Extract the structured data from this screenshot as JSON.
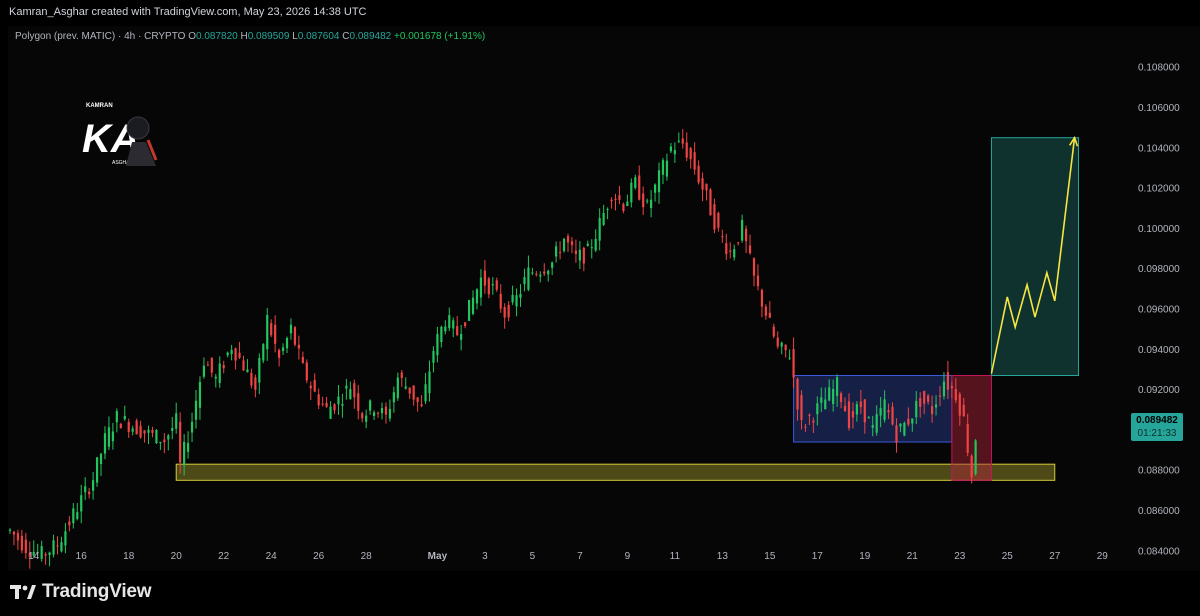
{
  "header": {
    "created_text": "Kamran_Asghar created with TradingView.com, May 23, 2026 14:38 UTC"
  },
  "legend": {
    "symbol": "Polygon (prev. MATIC) · 4h · CRYPTO",
    "open_key": "O",
    "open": "0.087820",
    "high_key": "H",
    "high": "0.089509",
    "low_key": "L",
    "low": "0.087604",
    "close_key": "C",
    "close": "0.089482",
    "change": "+0.001678 (+1.91%)"
  },
  "watermark": {
    "top_text": "KAMRAN",
    "letters": "KA",
    "bottom_text": "ASGHAR"
  },
  "price_tag": {
    "price": "0.089482",
    "countdown": "01:21:33"
  },
  "footer": {
    "brand": "TradingView"
  },
  "colors": {
    "up": "#22c55e",
    "down": "#ef4444",
    "support": "#d4cc3a",
    "range": "#3b5bdb",
    "target": "#26a69a",
    "stop": "#b4233a",
    "projection": "#f5e642"
  },
  "chart_data": {
    "type": "candlestick",
    "title": "",
    "y_axis": {
      "min": 0.083,
      "max": 0.109,
      "ticks": [
        0.084,
        0.086,
        0.088,
        0.09,
        0.092,
        0.094,
        0.096,
        0.098,
        0.1,
        0.102,
        0.104,
        0.106,
        0.108
      ],
      "tick_labels": [
        "0.084000",
        "0.086000",
        "0.088000",
        "0.090000",
        "0.092000",
        "0.094000",
        "0.096000",
        "0.098000",
        "0.100000",
        "0.102000",
        "0.104000",
        "0.106000",
        "0.108000"
      ]
    },
    "x_axis": {
      "start": "2026-04-13",
      "end": "2026-05-30",
      "ticks": [
        {
          "date": "2026-04-14",
          "label": "14"
        },
        {
          "date": "2026-04-16",
          "label": "16"
        },
        {
          "date": "2026-04-18",
          "label": "18"
        },
        {
          "date": "2026-04-20",
          "label": "20"
        },
        {
          "date": "2026-04-22",
          "label": "22"
        },
        {
          "date": "2026-04-24",
          "label": "24"
        },
        {
          "date": "2026-04-26",
          "label": "26"
        },
        {
          "date": "2026-04-28",
          "label": "28"
        },
        {
          "date": "2026-05-01",
          "label": "May"
        },
        {
          "date": "2026-05-03",
          "label": "3"
        },
        {
          "date": "2026-05-05",
          "label": "5"
        },
        {
          "date": "2026-05-07",
          "label": "7"
        },
        {
          "date": "2026-05-09",
          "label": "9"
        },
        {
          "date": "2026-05-11",
          "label": "11"
        },
        {
          "date": "2026-05-13",
          "label": "13"
        },
        {
          "date": "2026-05-15",
          "label": "15"
        },
        {
          "date": "2026-05-17",
          "label": "17"
        },
        {
          "date": "2026-05-19",
          "label": "19"
        },
        {
          "date": "2026-05-21",
          "label": "21"
        },
        {
          "date": "2026-05-23",
          "label": "23"
        },
        {
          "date": "2026-05-25",
          "label": "25"
        },
        {
          "date": "2026-05-27",
          "label": "27"
        },
        {
          "date": "2026-05-29",
          "label": "29"
        }
      ]
    },
    "price_path": [
      [
        "2026-04-13 00:00",
        0.085
      ],
      [
        "2026-04-13 16:00",
        0.0842
      ],
      [
        "2026-04-14 08:00",
        0.0838
      ],
      [
        "2026-04-15 00:00",
        0.0843
      ],
      [
        "2026-04-15 16:00",
        0.0858
      ],
      [
        "2026-04-16 12:00",
        0.0876
      ],
      [
        "2026-04-17 00:00",
        0.0895
      ],
      [
        "2026-04-17 12:00",
        0.0906
      ],
      [
        "2026-04-18 08:00",
        0.0901
      ],
      [
        "2026-04-18 20:00",
        0.0898
      ],
      [
        "2026-04-19 12:00",
        0.0895
      ],
      [
        "2026-04-20 00:00",
        0.0904
      ],
      [
        "2026-04-20 04:00",
        0.0882
      ],
      [
        "2026-04-20 16:00",
        0.0905
      ],
      [
        "2026-04-21 04:00",
        0.0935
      ],
      [
        "2026-04-21 16:00",
        0.0925
      ],
      [
        "2026-04-22 08:00",
        0.0942
      ],
      [
        "2026-04-22 20:00",
        0.0932
      ],
      [
        "2026-04-23 08:00",
        0.092
      ],
      [
        "2026-04-23 20:00",
        0.0955
      ],
      [
        "2026-04-24 08:00",
        0.0935
      ],
      [
        "2026-04-24 20:00",
        0.095
      ],
      [
        "2026-04-25 08:00",
        0.093
      ],
      [
        "2026-04-25 20:00",
        0.0918
      ],
      [
        "2026-04-26 08:00",
        0.091
      ],
      [
        "2026-04-26 20:00",
        0.0915
      ],
      [
        "2026-04-27 08:00",
        0.0922
      ],
      [
        "2026-04-27 20:00",
        0.0908
      ],
      [
        "2026-04-28 08:00",
        0.0912
      ],
      [
        "2026-04-28 20:00",
        0.0906
      ],
      [
        "2026-04-29 08:00",
        0.0926
      ],
      [
        "2026-04-29 20:00",
        0.092
      ],
      [
        "2026-04-30 08:00",
        0.091
      ],
      [
        "2026-04-30 20:00",
        0.094
      ],
      [
        "2026-05-01 08:00",
        0.0955
      ],
      [
        "2026-05-01 20:00",
        0.0948
      ],
      [
        "2026-05-02 08:00",
        0.096
      ],
      [
        "2026-05-02 20:00",
        0.0975
      ],
      [
        "2026-05-03 08:00",
        0.097
      ],
      [
        "2026-05-03 20:00",
        0.0958
      ],
      [
        "2026-05-04 08:00",
        0.0965
      ],
      [
        "2026-05-04 20:00",
        0.0978
      ],
      [
        "2026-05-05 08:00",
        0.098
      ],
      [
        "2026-05-05 20:00",
        0.0983
      ],
      [
        "2026-05-06 08:00",
        0.0995
      ],
      [
        "2026-05-06 20:00",
        0.0985
      ],
      [
        "2026-05-07 08:00",
        0.0988
      ],
      [
        "2026-05-07 20:00",
        0.1002
      ],
      [
        "2026-05-08 08:00",
        0.1018
      ],
      [
        "2026-05-08 20:00",
        0.1012
      ],
      [
        "2026-05-09 08:00",
        0.1022
      ],
      [
        "2026-05-09 20:00",
        0.101
      ],
      [
        "2026-05-10 08:00",
        0.1025
      ],
      [
        "2026-05-10 20:00",
        0.104
      ],
      [
        "2026-05-11 08:00",
        0.1042
      ],
      [
        "2026-05-11 20:00",
        0.103
      ],
      [
        "2026-05-12 08:00",
        0.1015
      ],
      [
        "2026-05-12 20:00",
        0.0998
      ],
      [
        "2026-05-13 08:00",
        0.0988
      ],
      [
        "2026-05-13 20:00",
        0.1
      ],
      [
        "2026-05-14 08:00",
        0.0975
      ],
      [
        "2026-05-14 20:00",
        0.0958
      ],
      [
        "2026-05-15 08:00",
        0.094
      ],
      [
        "2026-05-15 20:00",
        0.0938
      ],
      [
        "2026-05-16 08:00",
        0.0902
      ],
      [
        "2026-05-16 20:00",
        0.0908
      ],
      [
        "2026-05-17 08:00",
        0.0915
      ],
      [
        "2026-05-17 20:00",
        0.0922
      ],
      [
        "2026-05-18 08:00",
        0.0905
      ],
      [
        "2026-05-18 20:00",
        0.0912
      ],
      [
        "2026-05-19 08:00",
        0.09
      ],
      [
        "2026-05-19 20:00",
        0.0913
      ],
      [
        "2026-05-20 08:00",
        0.0898
      ],
      [
        "2026-05-20 20:00",
        0.0905
      ],
      [
        "2026-05-21 08:00",
        0.0915
      ],
      [
        "2026-05-21 20:00",
        0.091
      ],
      [
        "2026-05-22 08:00",
        0.0925
      ],
      [
        "2026-05-22 20:00",
        0.0918
      ],
      [
        "2026-05-23 04:00",
        0.0905
      ],
      [
        "2026-05-23 12:00",
        0.0878
      ],
      [
        "2026-05-23 16:00",
        0.08948
      ]
    ],
    "last_price": 0.089482,
    "zones": [
      {
        "kind": "support",
        "from": "2026-04-20 00:00",
        "to": "2026-05-27 00:00",
        "low": 0.0875,
        "high": 0.0883
      },
      {
        "kind": "range",
        "from": "2026-05-16 00:00",
        "to": "2026-05-22 16:00",
        "low": 0.0894,
        "high": 0.0927
      },
      {
        "kind": "stop",
        "from": "2026-05-22 16:00",
        "to": "2026-05-24 08:00",
        "low": 0.0875,
        "high": 0.0927
      },
      {
        "kind": "target",
        "from": "2026-05-24 08:00",
        "to": "2026-05-28 00:00",
        "low": 0.0927,
        "high": 0.1045
      }
    ],
    "projection": [
      [
        "2026-05-24 08:00",
        0.0928
      ],
      [
        "2026-05-25 00:00",
        0.0966
      ],
      [
        "2026-05-25 08:00",
        0.0951
      ],
      [
        "2026-05-25 20:00",
        0.0972
      ],
      [
        "2026-05-26 04:00",
        0.0956
      ],
      [
        "2026-05-26 16:00",
        0.0978
      ],
      [
        "2026-05-27 00:00",
        0.0964
      ],
      [
        "2026-05-27 20:00",
        0.1045
      ]
    ]
  }
}
